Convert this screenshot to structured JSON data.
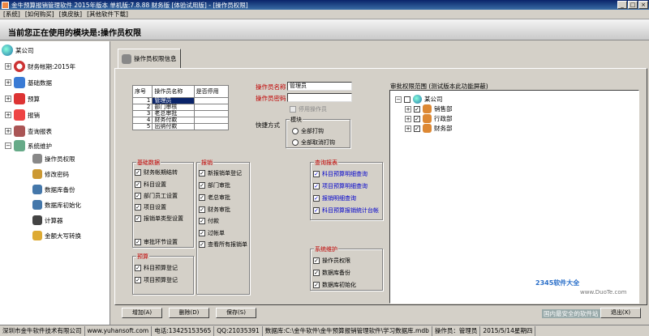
{
  "window": {
    "title": "金牛预算报销管理软件 2015年版本 单机版:7.8.88 财务版 [体验试用版] - [操作员权限]"
  },
  "menu": [
    "[系统]",
    "[如何购买]",
    "[换皮肤]",
    "[其他软件下载]"
  ],
  "banner": {
    "text": "当前您正在使用的模块是:操作员权限"
  },
  "sidebar": {
    "root": "某公司",
    "items": [
      "财务帐期:2015年",
      "基础数据",
      "预算",
      "报销",
      "查询报表",
      "系统维护"
    ],
    "subitems": [
      "操作员权限",
      "修改密码",
      "数据库备份",
      "数据库初始化",
      "计算器",
      "金额大写转换"
    ]
  },
  "tab": {
    "label": "操作员权限信息"
  },
  "operators_table": {
    "headers": [
      "序号",
      "操作员名称",
      "是否停用"
    ],
    "rows": [
      {
        "no": "1",
        "name": "管理员"
      },
      {
        "no": "2",
        "name": "部门审核"
      },
      {
        "no": "3",
        "name": "老总审批"
      },
      {
        "no": "4",
        "name": "财务付款"
      },
      {
        "no": "5",
        "name": "出纳付款"
      }
    ]
  },
  "form": {
    "name_label": "操作员名称",
    "name_value": "管理员",
    "password_label": "操作员密码",
    "password_value": "",
    "disable_label": "停用操作员",
    "quick_label": "快捷方式",
    "module_label": "模块",
    "radio_all": "全部打钩",
    "radio_none": "全部取消打钩",
    "scope_label": "审批权限范围 (测试版本此功能屏蔽)"
  },
  "groups": {
    "basic": {
      "title": "基础数据",
      "items": [
        "财务帐期结转",
        "科目设置",
        "部门员工设置",
        "项目设置",
        "报销单类型设置",
        "审批环节设置"
      ]
    },
    "reimburse": {
      "title": "报销",
      "items": [
        "新报销单登记",
        "部门审批",
        "老总审批",
        "财务审批",
        "付款",
        "过帐单",
        "查看所有报销单"
      ]
    },
    "budget": {
      "title": "预算",
      "items": [
        "科目预算登记",
        "项目预算登记"
      ]
    },
    "query": {
      "title": "查询报表",
      "items": [
        "科目预算明细查询",
        "项目预算明细查询",
        "报销明细查询",
        "科目预算报销统计台帐"
      ]
    },
    "sysmaint": {
      "title": "系统维护",
      "items": [
        "操作员权限",
        "数据库备份",
        "数据库初始化"
      ]
    }
  },
  "scope_tree": {
    "root": "某公司",
    "children": [
      "销售部",
      "行政部",
      "财务部"
    ]
  },
  "buttons": {
    "add": "增加(A)",
    "delete": "删除(D)",
    "save": "保存(S)",
    "exit": "退出(X)"
  },
  "status": [
    "深圳市金牛软件技术有限公司",
    "www.yuhansoft.com",
    "电话:13425153565",
    "QQ:21035391",
    "数据库:C:\\金牛软件\\金牛预算报销管理软件\\学习数据库.mdb",
    "操作员：管理员",
    "2015/5/14星期四"
  ],
  "watermark": {
    "text": "国内最安全的软件站",
    "logo": "2345软件大全",
    "url": "www.DuoTe.com"
  },
  "colors": {
    "title_bar": "#0a246a",
    "label_red": "#c00000",
    "selection": "#0a246a",
    "window_bg": "#d4d0c8"
  }
}
